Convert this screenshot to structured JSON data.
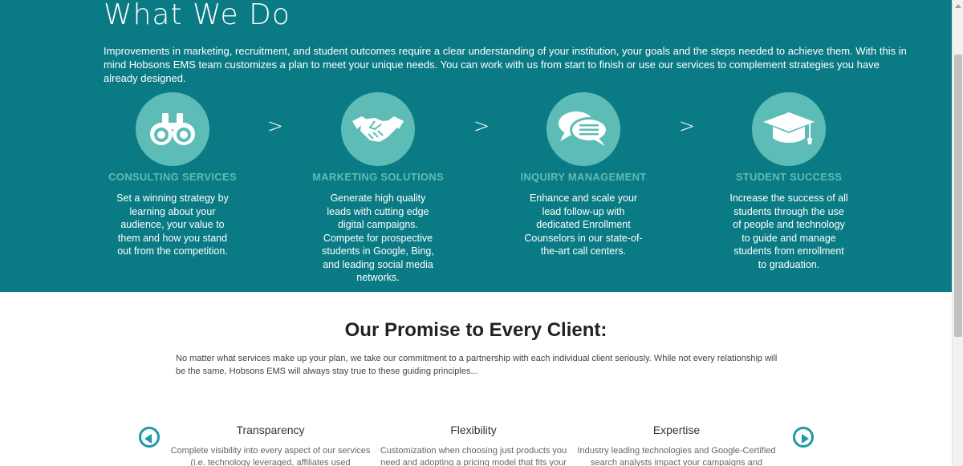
{
  "header": {
    "title": "What We Do",
    "intro": "Improvements in marketing, recruitment, and student outcomes require a clear understanding of your institution, your goals and the steps needed to achieve them. With this in mind Hobsons EMS team customizes a plan to meet your unique needs. You can work with us from start to finish or use our services to complement strategies you have already designed."
  },
  "services": [
    {
      "icon": "binoculars-icon",
      "title": "CONSULTING SERVICES",
      "text": "Set a winning strategy by learning about your audience, your value to them and how you stand out from the competition."
    },
    {
      "icon": "handshake-icon",
      "title": "MARKETING SOLUTIONS",
      "text": "Generate high quality leads with cutting edge digital campaigns. Compete for prospective students in Google, Bing, and leading social media networks."
    },
    {
      "icon": "speech-bubbles-icon",
      "title": "INQUIRY MANAGEMENT",
      "text": "Enhance and scale your lead follow-up with dedicated Enrollment Counselors in our state-of-the-art call centers."
    },
    {
      "icon": "graduation-cap-icon",
      "title": "STUDENT SUCCESS",
      "text": "Increase the success of all students through the use of people and technology to guide and manage students from enrollment to graduation."
    }
  ],
  "separator": ">",
  "promise": {
    "title": "Our Promise to Every Client:",
    "text": "No matter what services make up your plan, we take our commitment to a partnership with each individual client seriously. While not every relationship will be the same, Hobsons EMS will always stay true to these guiding principles..."
  },
  "principles": [
    {
      "title": "Transparency",
      "text": "Complete visibility into every aspect of our services (i.e. technology leveraged, affiliates used"
    },
    {
      "title": "Flexibility",
      "text": "Customization when choosing just products you need and adopting a pricing model that fits your"
    },
    {
      "title": "Expertise",
      "text": "Industry leading technologies and Google-Certified search analysts impact your campaigns and"
    }
  ],
  "colors": {
    "teal_background": "#0a7b84",
    "accent_light_teal": "#5ebcb6",
    "carousel_button": "#1f9aa6"
  }
}
